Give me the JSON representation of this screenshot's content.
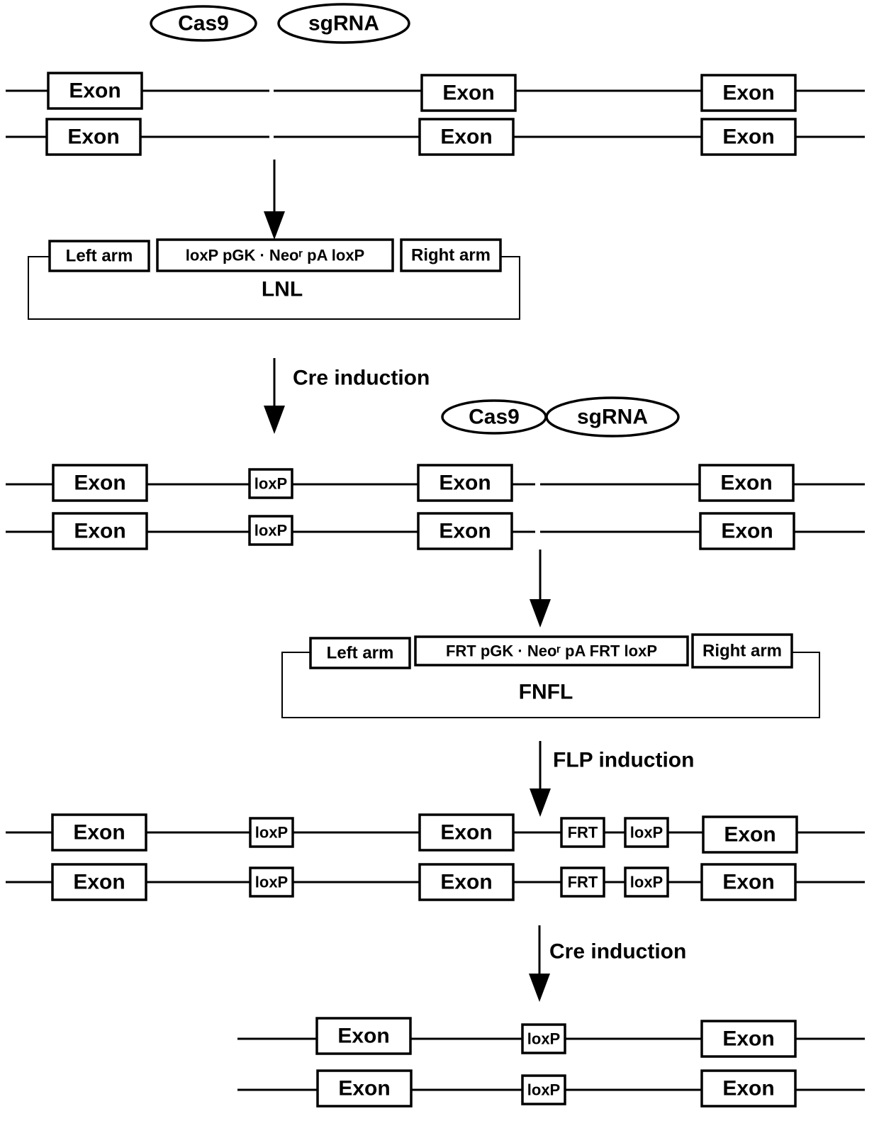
{
  "reagents": {
    "cas9": "Cas9",
    "sgrna": "sgRNA"
  },
  "labels": {
    "exon": "Exon",
    "loxp": "loxP",
    "frt": "FRT",
    "left_arm": "Left arm",
    "right_arm": "Right arm"
  },
  "vectors": {
    "lnl": {
      "name": "LNL",
      "cassette": "loxP   pGK  · Neoʳ pA  loxP"
    },
    "fnfl": {
      "name": "FNFL",
      "cassette": "FRT   pGK  · Neoʳ pA FRT loxP"
    }
  },
  "steps": {
    "cre1": "Cre induction",
    "flp": "FLP induction",
    "cre2": "Cre induction"
  }
}
